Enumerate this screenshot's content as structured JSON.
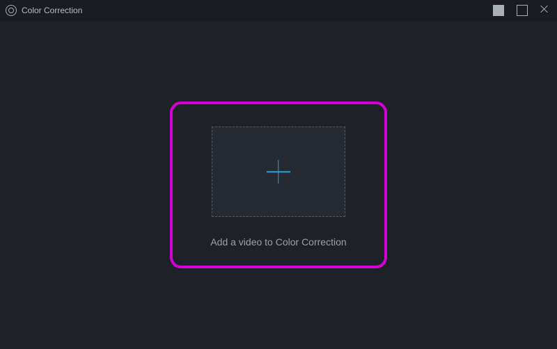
{
  "window": {
    "title": "Color Correction"
  },
  "drop": {
    "caption": "Add a video to Color Correction"
  },
  "colors": {
    "accent": "#2aa3d9",
    "highlight": "#d400d4"
  }
}
